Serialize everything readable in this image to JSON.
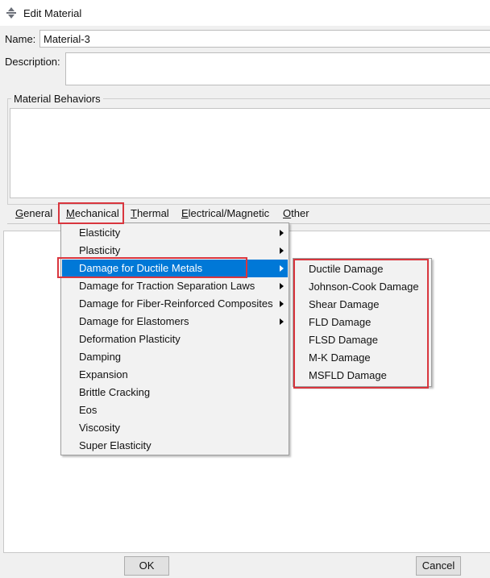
{
  "window": {
    "title": "Edit Material",
    "icon": "abaqus-material-icon"
  },
  "form": {
    "name_label": "Name:",
    "name_value": "Material-3",
    "description_label": "Description:",
    "description_value": "",
    "behaviors_group_title": "Material Behaviors"
  },
  "tabs": [
    {
      "label": "General",
      "mnemonic": "G",
      "rest": "eneral"
    },
    {
      "label": "Mechanical",
      "mnemonic": "M",
      "rest": "echanical",
      "active": true
    },
    {
      "label": "Thermal",
      "mnemonic": "T",
      "rest": "hermal"
    },
    {
      "label": "Electrical/Magnetic",
      "mnemonic": "E",
      "rest": "lectrical/Magnetic"
    },
    {
      "label": "Other",
      "mnemonic": "O",
      "rest": "ther"
    }
  ],
  "mechanical_menu": {
    "items": [
      {
        "label": "Elasticity",
        "submenu": true
      },
      {
        "label": "Plasticity",
        "submenu": true
      },
      {
        "label": "Damage for Ductile Metals",
        "submenu": true,
        "highlighted": true
      },
      {
        "label": "Damage for Traction Separation Laws",
        "submenu": true
      },
      {
        "label": "Damage for Fiber-Reinforced Composites",
        "submenu": true
      },
      {
        "label": "Damage for Elastomers",
        "submenu": true
      },
      {
        "label": "Deformation Plasticity",
        "submenu": false
      },
      {
        "label": "Damping",
        "submenu": false
      },
      {
        "label": "Expansion",
        "submenu": false
      },
      {
        "label": "Brittle Cracking",
        "submenu": false
      },
      {
        "label": "Eos",
        "submenu": false
      },
      {
        "label": "Viscosity",
        "submenu": false
      },
      {
        "label": "Super Elasticity",
        "submenu": false
      }
    ]
  },
  "ductile_damage_submenu": {
    "items": [
      "Ductile Damage",
      "Johnson-Cook Damage",
      "Shear Damage",
      "FLD Damage",
      "FLSD Damage",
      "M-K Damage",
      "MSFLD Damage"
    ]
  },
  "buttons": {
    "ok": "OK",
    "cancel": "Cancel"
  },
  "colors": {
    "highlight": "#0078d7",
    "annotation_box": "#d9363e"
  }
}
